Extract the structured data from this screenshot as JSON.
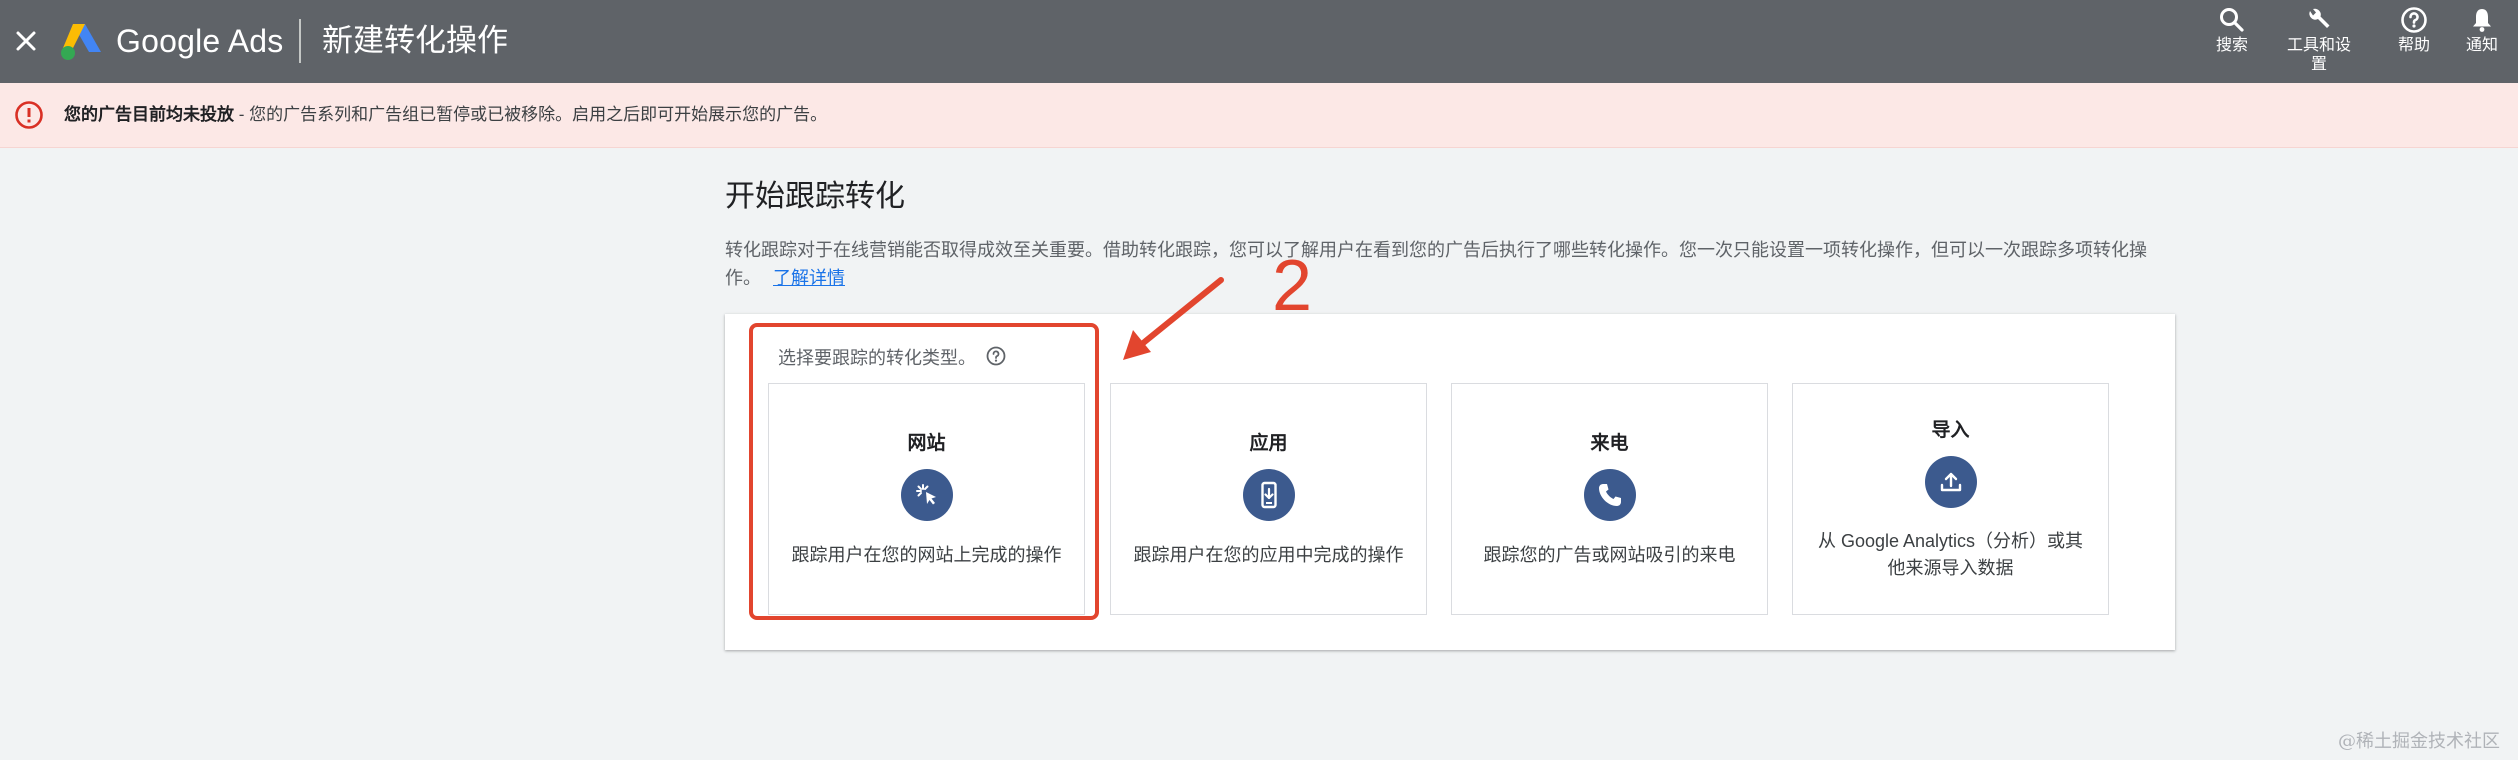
{
  "topbar": {
    "brand": "Google Ads",
    "page_title": "新建转化操作",
    "tools": [
      {
        "label": "搜索",
        "icon": "search-icon"
      },
      {
        "label": "工具和设置",
        "icon": "wrench-icon"
      },
      {
        "label": "帮助",
        "icon": "help-icon"
      },
      {
        "label": "通知",
        "icon": "bell-icon"
      }
    ]
  },
  "alert": {
    "bold": "您的广告目前均未投放",
    "text": " - 您的广告系列和广告组已暂停或已被移除。启用之后即可开始展示您的广告。"
  },
  "main": {
    "heading": "开始跟踪转化",
    "description": "转化跟踪对于在线营销能否取得成效至关重要。借助转化跟踪，您可以了解用户在看到您的广告后执行了哪些转化操作。您一次只能设置一项转化操作，但可以一次跟踪多项转化操作。",
    "learn_more": "了解详情",
    "prompt": "选择要跟踪的转化类型。",
    "cards": [
      {
        "title": "网站",
        "icon": "cursor-click-icon",
        "desc": "跟踪用户在您的网站上完成的操作"
      },
      {
        "title": "应用",
        "icon": "mobile-app-icon",
        "desc": "跟踪用户在您的应用中完成的操作"
      },
      {
        "title": "来电",
        "icon": "phone-icon",
        "desc": "跟踪您的广告或网站吸引的来电"
      },
      {
        "title": "导入",
        "icon": "upload-icon",
        "desc": "从 Google Analytics（分析）或其他来源导入数据"
      }
    ]
  },
  "annotation": {
    "number": "2",
    "color": "#e2452e"
  },
  "watermark": "@稀土掘金技术社区",
  "colors": {
    "topbar": "#5f6368",
    "alert_bg": "#fce8e6",
    "alert_icon": "#d93025",
    "icon_circle": "#3c5a8e",
    "link": "#1a73e8"
  }
}
